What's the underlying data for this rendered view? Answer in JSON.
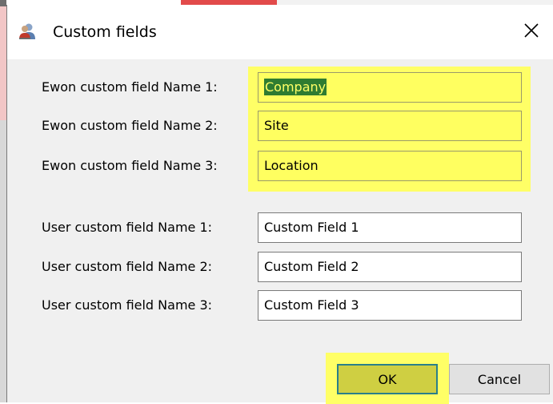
{
  "window": {
    "title": "Custom fields",
    "icon": "users-icon",
    "close_glyph": "✕"
  },
  "ewon_fields": [
    {
      "label": "Ewon custom field Name 1:",
      "value": "Company",
      "selected": true
    },
    {
      "label": "Ewon custom field Name 2:",
      "value": "Site",
      "selected": false
    },
    {
      "label": "Ewon custom field Name 3:",
      "value": "Location",
      "selected": false
    }
  ],
  "user_fields": [
    {
      "label": "User custom field Name 1:",
      "value": "Custom Field 1"
    },
    {
      "label": "User custom field Name 2:",
      "value": "Custom Field 2"
    },
    {
      "label": "User custom field Name 3:",
      "value": "Custom Field 3"
    }
  ],
  "buttons": {
    "ok_label": "OK",
    "cancel_label": "Cancel"
  },
  "colors": {
    "highlight": "#ffff66",
    "selection_bg": "#2f7c31",
    "dialog_bg": "#f0f0f0",
    "ok_border": "#2a7f8a"
  }
}
